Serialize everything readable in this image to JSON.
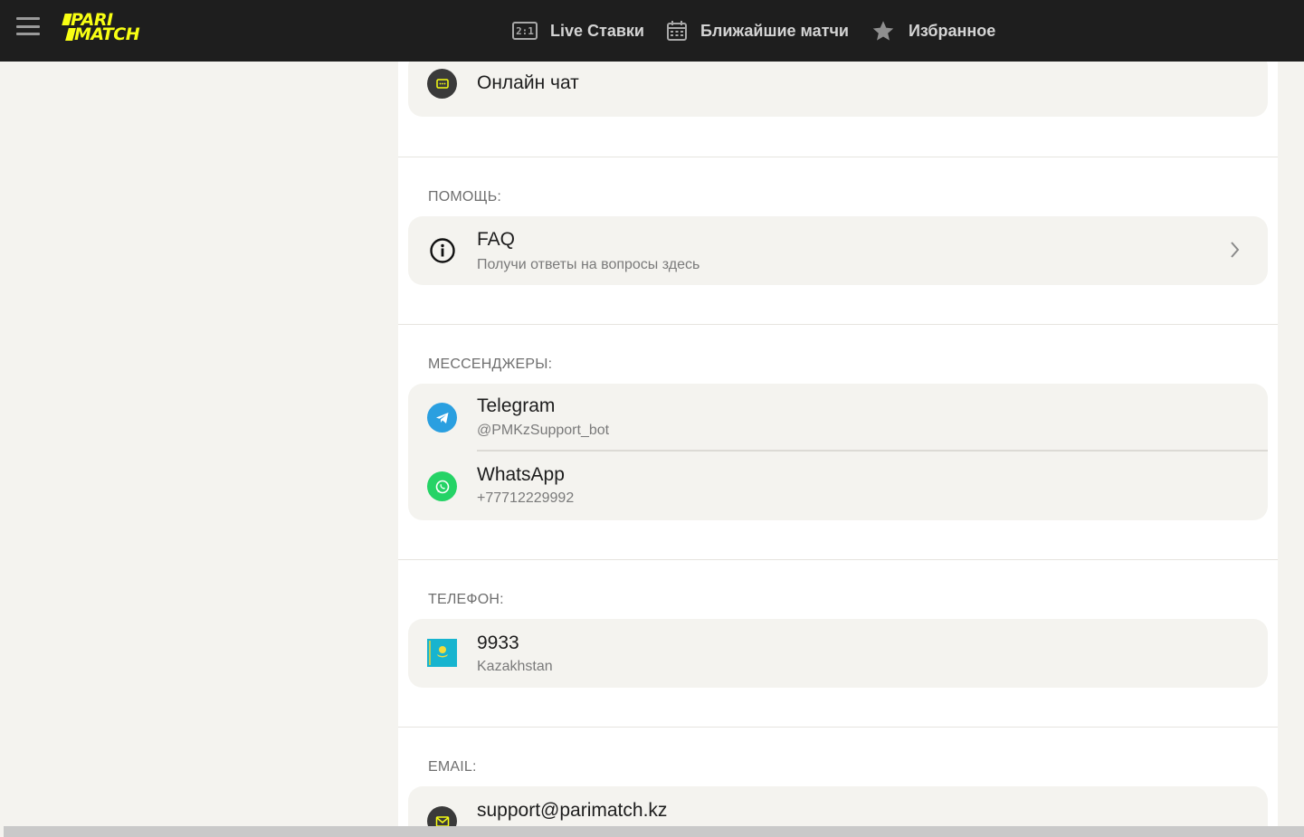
{
  "header": {
    "logo_line1": "PARI",
    "logo_line2": "MATCH",
    "logo_color": "#f8ff13",
    "nav": [
      {
        "icon": "score-2-1-icon",
        "icon_text": "2:1",
        "label": "Live Ставки"
      },
      {
        "icon": "calendar-icon",
        "label": "Ближайшие матчи"
      },
      {
        "icon": "star-icon",
        "label": "Избранное"
      }
    ]
  },
  "online_chat": {
    "icon": "chat-icon",
    "title": "Онлайн чат"
  },
  "help": {
    "label": "ПОМОЩЬ:",
    "faq_title": "FAQ",
    "faq_subtitle": "Получи ответы на вопросы здесь"
  },
  "messengers": {
    "label": "МЕССЕНДЖЕРЫ:",
    "telegram_title": "Telegram",
    "telegram_subtitle": "@PMKzSupport_bot",
    "telegram_color": "#2a9fe0",
    "whatsapp_title": "WhatsApp",
    "whatsapp_subtitle": "+77712229992",
    "whatsapp_color": "#25d366"
  },
  "phone": {
    "label": "ТЕЛЕФОН:",
    "number": "9933",
    "country": "Kazakhstan"
  },
  "email": {
    "label": "EMAIL:",
    "address": "support@parimatch.kz"
  }
}
